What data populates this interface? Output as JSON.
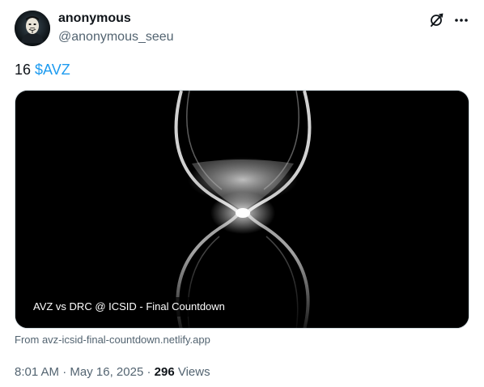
{
  "author": {
    "name": "anonymous",
    "handle": "@anonymous_seeu",
    "avatar_icon": "guy-fawkes-mask-avatar"
  },
  "header_actions": {
    "grok_icon": "grok-icon",
    "more_icon": "more-icon"
  },
  "tweet": {
    "text_number": "16",
    "cashtag": "$AVZ"
  },
  "card": {
    "image_icon": "hourglass-image",
    "label": "AVZ vs DRC @ ICSID - Final Countdown",
    "source": "From avz-icsid-final-countdown.netlify.app"
  },
  "meta": {
    "time": "8:01 AM",
    "separator1": "·",
    "date": "May 16, 2025",
    "separator2": "·",
    "views_count": "296",
    "views_label": "Views"
  },
  "colors": {
    "link": "#1d9bf0",
    "secondary_text": "#536471",
    "primary_text": "#0f1419"
  }
}
